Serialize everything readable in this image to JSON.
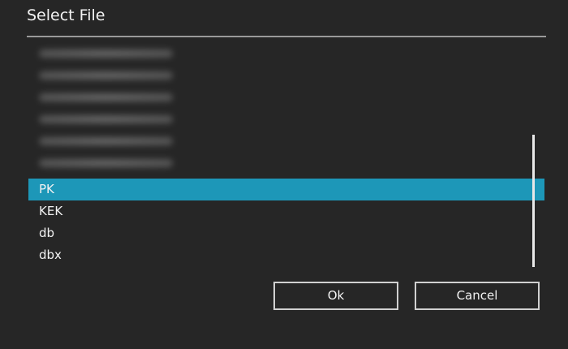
{
  "dialog": {
    "title": "Select File"
  },
  "file_list": {
    "blurred_count": 6,
    "items": [
      {
        "label": "PK",
        "selected": true
      },
      {
        "label": "KEK",
        "selected": false
      },
      {
        "label": "db",
        "selected": false
      },
      {
        "label": "dbx",
        "selected": false
      }
    ]
  },
  "buttons": {
    "ok_label": "Ok",
    "cancel_label": "Cancel"
  },
  "colors": {
    "background": "#262626",
    "selection": "#1d97b8",
    "text": "#f2f2f2",
    "border": "#d0d0d0"
  }
}
